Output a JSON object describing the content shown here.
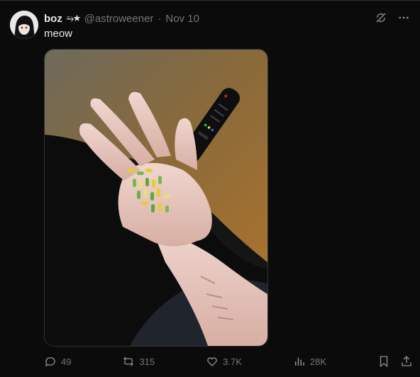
{
  "post": {
    "display_name": "boz",
    "badge": "⥱★",
    "handle": "@astroweener",
    "separator": "·",
    "date": "Nov 10",
    "text": "meow"
  },
  "actions": {
    "replies": "49",
    "reposts": "315",
    "likes": "3.7K",
    "views": "28K"
  },
  "icons": {
    "header": [
      "grok-icon",
      "more-icon"
    ],
    "actions": [
      "reply-icon",
      "repost-icon",
      "like-icon",
      "views-icon",
      "bookmark-icon",
      "share-icon"
    ]
  },
  "colors": {
    "background": "#0b0b0b",
    "text": "#e7e9ea",
    "muted": "#71767b",
    "border": "#2f3336"
  }
}
